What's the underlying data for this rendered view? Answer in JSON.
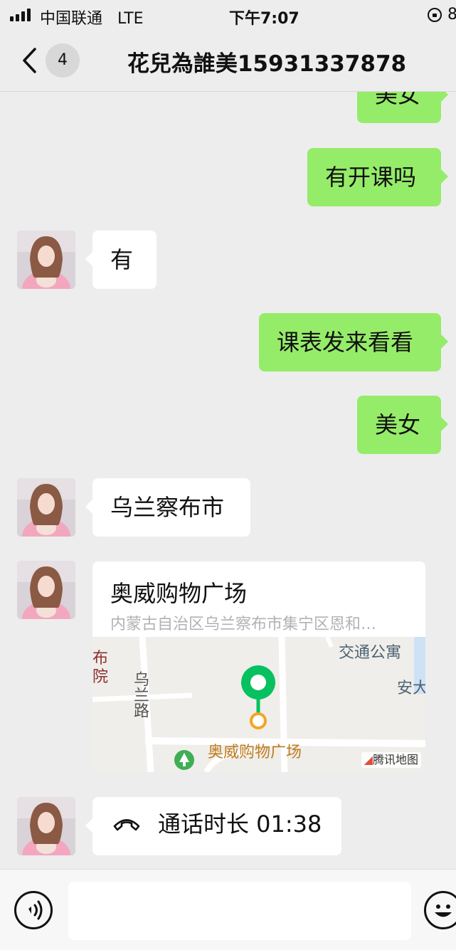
{
  "status_bar": {
    "carrier": "中国联通",
    "network": "LTE",
    "time": "下午7:07",
    "battery": "8"
  },
  "header": {
    "unread_count": "4",
    "title": "花兒為誰美15931337878"
  },
  "messages": {
    "m0": "美女",
    "m1": "有开课吗",
    "m2": "有",
    "m3": "课表发来看看",
    "m4": "美女",
    "m5": "乌兰察布市",
    "m6": {
      "place": "奥威购物广场",
      "address": "内蒙古自治区乌兰察布市集宁区恩和…",
      "map_labels": {
        "jiaotong": "交通公寓",
        "anda": "安大",
        "wulan_road": "乌兰路",
        "bu": "布",
        "yuan": "院",
        "pin": "奥威购物广场"
      },
      "map_brand": "腾讯地图"
    },
    "m7": {
      "call_text": "通话时长 01:38"
    }
  },
  "input_bar": {
    "placeholder": ""
  },
  "colors": {
    "outgoing": "#95ec69",
    "incoming": "#ffffff",
    "background": "#ededed",
    "pin": "#07c160"
  }
}
